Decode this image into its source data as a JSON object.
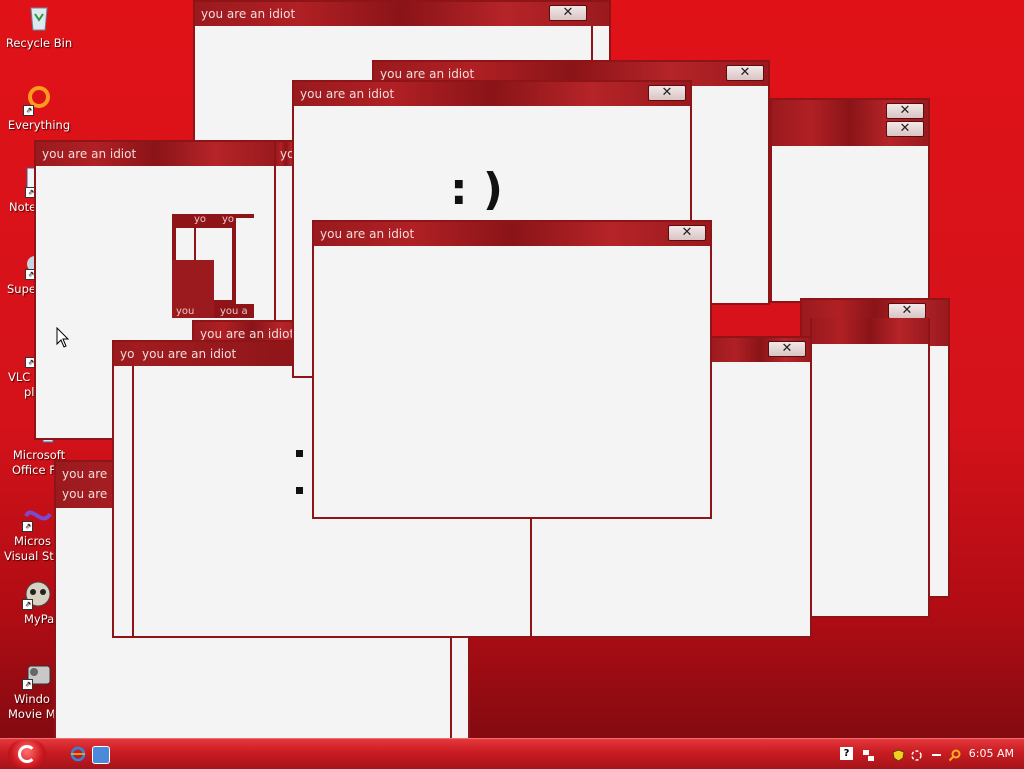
{
  "desktop": {
    "icons": [
      {
        "label": "Recycle Bin",
        "icon": "recycle-bin-icon"
      },
      {
        "label": "Everything",
        "icon": "everything-icon"
      },
      {
        "label": "Note",
        "icon": "notepad-icon"
      },
      {
        "label": "Supe",
        "icon": "super-icon"
      },
      {
        "label": "VLC",
        "label2": "pl",
        "icon": "vlc-icon"
      },
      {
        "label": "Microsoft",
        "label2": "Office F",
        "icon": "office-icon"
      },
      {
        "label": "Micros",
        "label2": "Visual St",
        "icon": "visual-studio-icon"
      },
      {
        "label": "MyPa",
        "icon": "mypaint-icon"
      },
      {
        "label": "Windo",
        "label2": "Movie Ma",
        "icon": "movie-maker-icon"
      }
    ]
  },
  "windows": {
    "title": "you are an idiot",
    "title_fragment": "yo",
    "title_fragment_short": "you are a",
    "close_label": "✕",
    "face_smile": ": )",
    "frag_text_1": "yo",
    "frag_text_2": "you",
    "frag_text_3": "you a"
  },
  "taskbar": {
    "clock": "6:05 AM"
  }
}
